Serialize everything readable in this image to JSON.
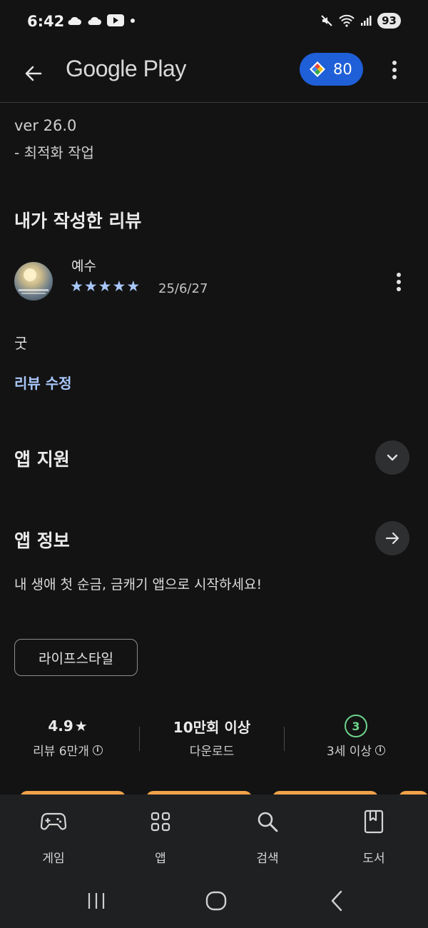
{
  "status_bar": {
    "time": "6:42",
    "battery": "93",
    "icons_left": [
      "cloud-icon",
      "cloud-icon",
      "youtube-icon",
      "dot-icon"
    ],
    "icons_right": [
      "mute-icon",
      "wifi-icon",
      "signal-icon",
      "battery-icon"
    ]
  },
  "app_bar": {
    "title": "Google Play",
    "points": "80"
  },
  "whats_new": {
    "version": "ver 26.0",
    "note": "- 최적화 작업"
  },
  "my_review": {
    "title": "내가 작성한 리뷰",
    "reviewer": "예수",
    "rating": 5,
    "stars": [
      "★",
      "★",
      "★",
      "★",
      "★"
    ],
    "date": "25/6/27",
    "text": "굿",
    "edit_label": "리뷰 수정"
  },
  "app_support": {
    "title": "앱 지원"
  },
  "app_info": {
    "title": "앱 정보",
    "description": "내 생애 첫 순금, 금캐기 앱으로 시작하세요!",
    "category": "라이프스타일"
  },
  "stats": {
    "rating": "4.9",
    "rating_star": "★",
    "reviews": "리뷰 6만개",
    "downloads": "10만회 이상",
    "downloads_label": "다운로드",
    "age_rating": "3",
    "age_label": "3세 이상"
  },
  "bottom_nav": {
    "items": [
      {
        "label": "게임",
        "icon": "gamepad-icon"
      },
      {
        "label": "앱",
        "icon": "apps-grid-icon"
      },
      {
        "label": "검색",
        "icon": "search-icon"
      },
      {
        "label": "도서",
        "icon": "book-icon"
      }
    ]
  },
  "colors": {
    "background": "#131313",
    "accent": "#a8c7fa",
    "points_badge": "#1f5fd8",
    "age_badge": "#6dd58c"
  }
}
